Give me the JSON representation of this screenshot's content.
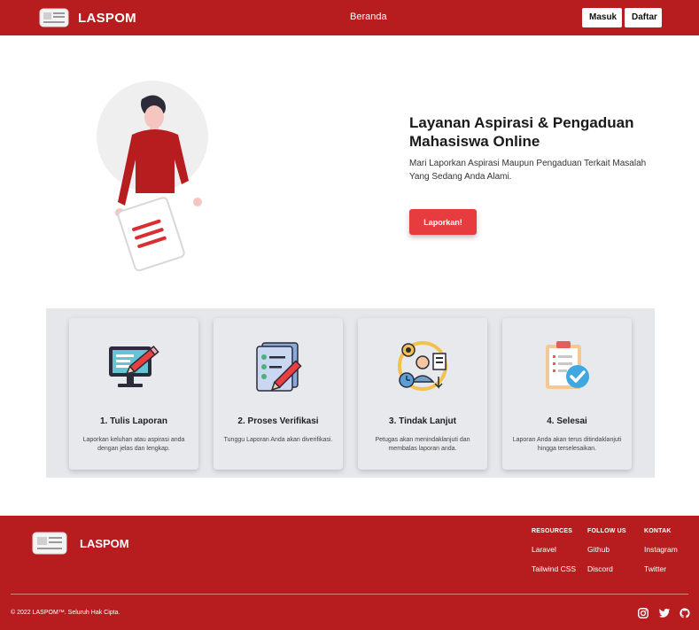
{
  "navbar": {
    "brand": "LASPOM",
    "link_home": "Beranda",
    "btn_login": "Masuk",
    "btn_register": "Daftar"
  },
  "hero": {
    "title": "Layanan Aspirasi & Pengaduan Mahasiswa Online",
    "description": "Mari Laporkan Aspirasi Maupun Pengaduan Terkait Masalah Yang Sedang Anda Alami.",
    "cta": "Laporkan!"
  },
  "steps": [
    {
      "icon": "computer-edit-icon",
      "title": "1. Tulis Laporan",
      "desc": "Laporkan keluhan atau aspirasi anda dengan jelas dan lengkap."
    },
    {
      "icon": "checklist-pencil-icon",
      "title": "2. Proses Verifikasi",
      "desc": "Tunggu Laporan Anda akan diverifikasi."
    },
    {
      "icon": "worker-gear-icon",
      "title": "3. Tindak Lanjut",
      "desc": "Petugas akan menindaklanjuti dan membalas laporan anda."
    },
    {
      "icon": "clipboard-check-icon",
      "title": "4. Selesai",
      "desc": "Laporan Anda akan terus ditindaklanjuti hingga terselesaikan."
    }
  ],
  "footer": {
    "brand": "LASPOM",
    "columns": [
      {
        "heading": "RESOURCES",
        "links": [
          "Laravel",
          "Tailwind CSS"
        ]
      },
      {
        "heading": "FOLLOW US",
        "links": [
          "Github",
          "Discord"
        ]
      },
      {
        "heading": "KONTAK",
        "links": [
          "Instagram",
          "Twitter"
        ]
      }
    ],
    "copyright": "© 2022 LASPOM™. Seluruh Hak Cipta.",
    "social_icons": [
      "instagram-icon",
      "twitter-icon",
      "github-icon"
    ]
  },
  "colors": {
    "primary": "#b71c1f",
    "cta": "#e63c40",
    "steps_bg": "#e5e7eb"
  }
}
